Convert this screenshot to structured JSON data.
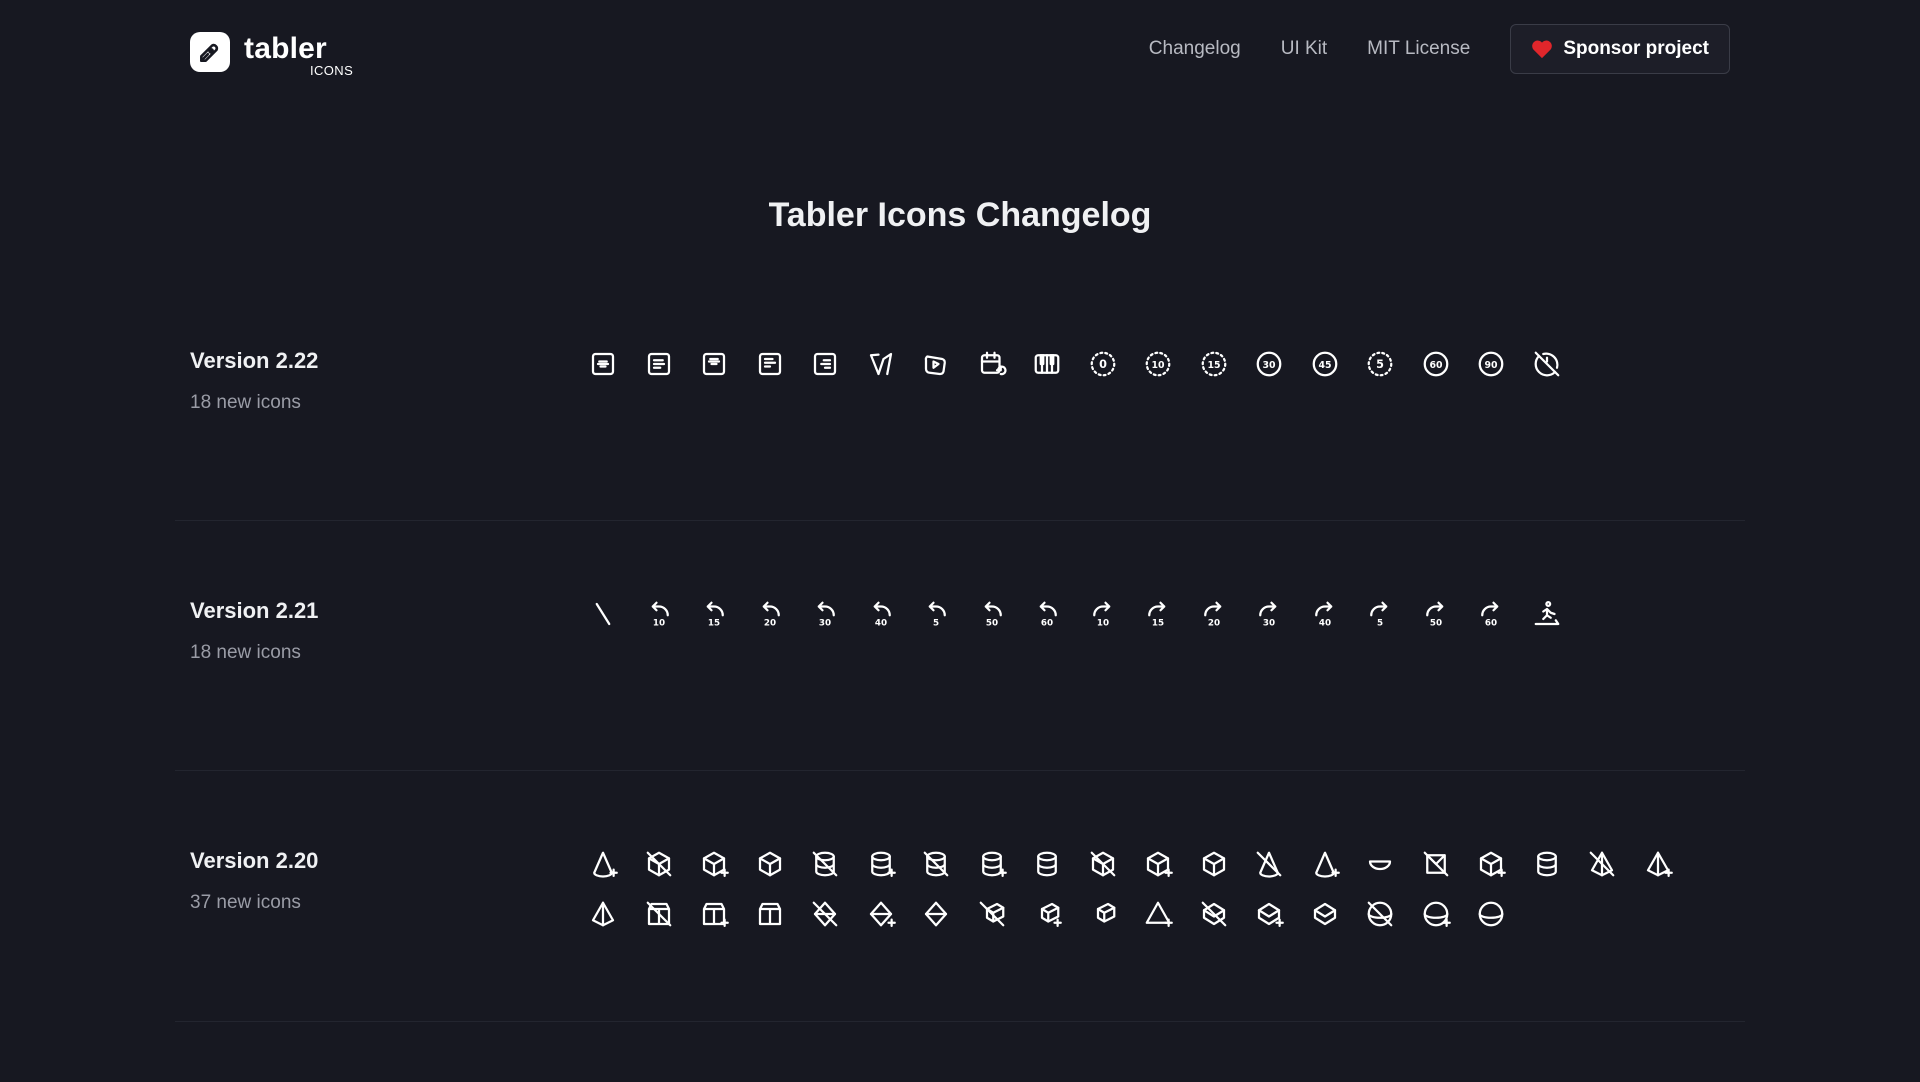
{
  "header": {
    "logo_word": "tabler",
    "logo_sub": "ICONS",
    "nav": [
      "Changelog",
      "UI Kit",
      "MIT License"
    ],
    "sponsor_label": "Sponsor project",
    "accent": "#e0262b"
  },
  "page_title": "Tabler Icons Changelog",
  "versions": [
    {
      "label": "Version 2.22",
      "count": "18 new icons",
      "icons": [
        "align-box-center-middle",
        "align-box-left-middle",
        "align-box-center-top",
        "align-box-left-top",
        "align-box-right-middle",
        "brand-vite",
        "brand-youtube-kids",
        "calendar-repeat",
        "piano",
        "clock-hour-0",
        "clock-10",
        "clock-15",
        "clock-30",
        "clock-45",
        "clock-5",
        "clock-60",
        "clock-90",
        "clock-off"
      ]
    },
    {
      "label": "Version 2.21",
      "count": "18 new icons",
      "icons": [
        "slash",
        "rewind-back-10",
        "rewind-back-15",
        "rewind-back-20",
        "rewind-back-30",
        "rewind-back-40",
        "rewind-back-5",
        "rewind-back-50",
        "rewind-back-60",
        "rewind-forward-10",
        "rewind-forward-15",
        "rewind-forward-20",
        "rewind-forward-30",
        "rewind-forward-40",
        "rewind-forward-5",
        "rewind-forward-50",
        "rewind-forward-60",
        "treadmill"
      ]
    },
    {
      "label": "Version 2.20",
      "count": "37 new icons",
      "icons": [
        "cone-plus",
        "cube-off",
        "cube-plus",
        "cube",
        "cylinder-off",
        "cylinder-plus",
        "hourglass-off",
        "database-plus",
        "cylinder",
        "cube-3d-off",
        "box-plus",
        "box",
        "cone-off",
        "cone-plus-2",
        "bowl",
        "cube-unfolded-off",
        "cube-plus-2",
        "cylinder-3d",
        "pyramid-off",
        "pyramid-plus",
        "pyramid",
        "prism-off",
        "prism-plus",
        "prism",
        "diamond-off",
        "diamond-plus",
        "diamond",
        "cube-send-off",
        "cube-send-plus",
        "cube-send",
        "triangle-plus",
        "box-model-off",
        "box-model-plus",
        "box-model",
        "sphere-off",
        "sphere-plus",
        "sphere"
      ]
    }
  ]
}
